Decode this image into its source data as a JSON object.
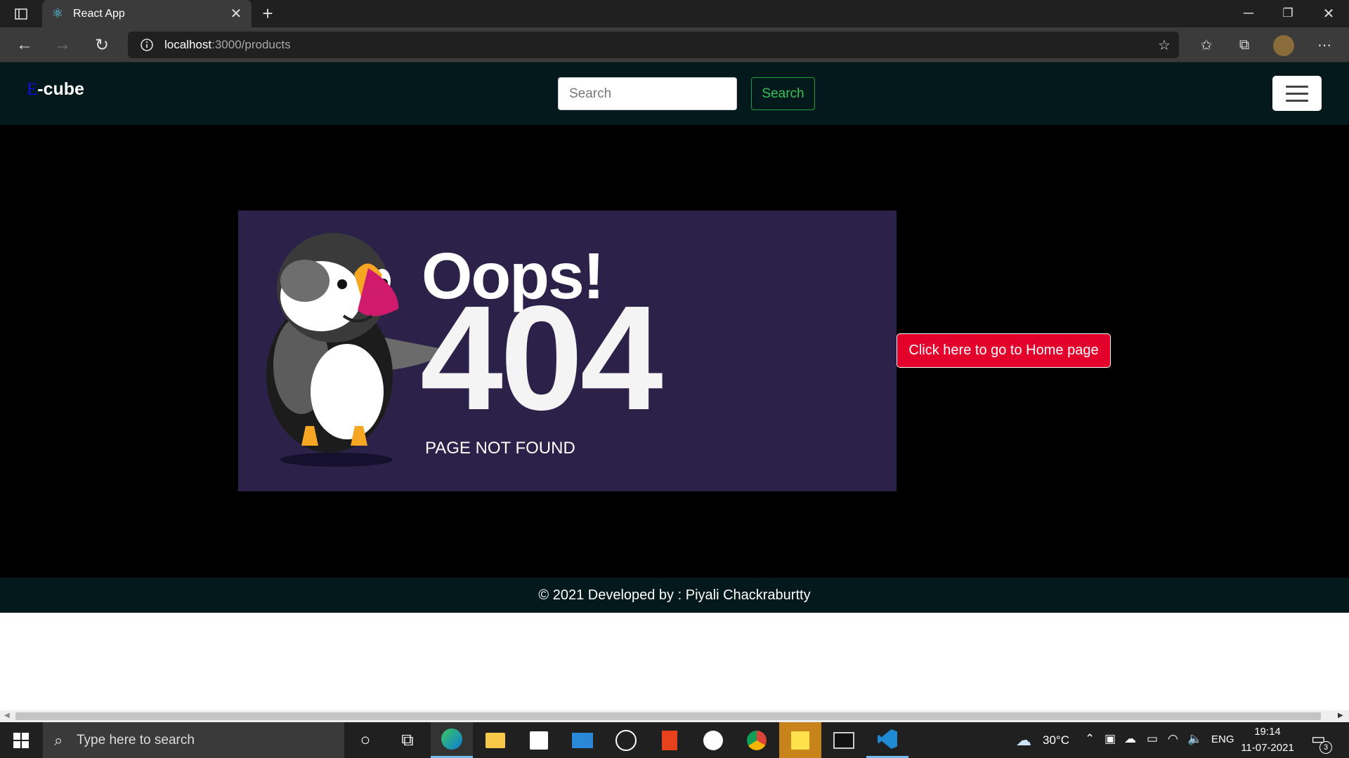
{
  "browser": {
    "tab_title": "React App",
    "tab_close": "✕",
    "new_tab": "+",
    "url_host": "localhost",
    "url_path": ":3000/products",
    "window_controls": {
      "minimize": "─",
      "restore": "❐",
      "close": "✕"
    }
  },
  "navbar": {
    "brand_letter": "E",
    "brand_rest": "-cube",
    "search_placeholder": "Search",
    "search_button": "Search"
  },
  "error_image": {
    "headline": "Oops!",
    "code": "404",
    "message": "PAGE NOT FOUND"
  },
  "home_button": "Click here to go to Home page",
  "footer": "© 2021 Developed by : Piyali Chackraburtty",
  "taskbar": {
    "search_placeholder": "Type here to search",
    "weather": "30°C",
    "language": "ENG",
    "time": "19:14",
    "date": "11-07-2021",
    "notifications": "3",
    "apps": [
      "cortana-icon",
      "task-view-icon",
      "edge-icon",
      "file-explorer-icon",
      "store-icon",
      "mail-icon",
      "dell-icon",
      "office-icon",
      "whatsapp-icon",
      "chrome-icon",
      "sticky-notes-icon",
      "terminal-icon",
      "vscode-icon"
    ]
  },
  "colors": {
    "navbar_bg": "#04191c",
    "panel_bg": "#2c2249",
    "home_button_bg": "#e3002b",
    "search_button_text": "#35c25a",
    "brand_letter": "#1010e0"
  }
}
